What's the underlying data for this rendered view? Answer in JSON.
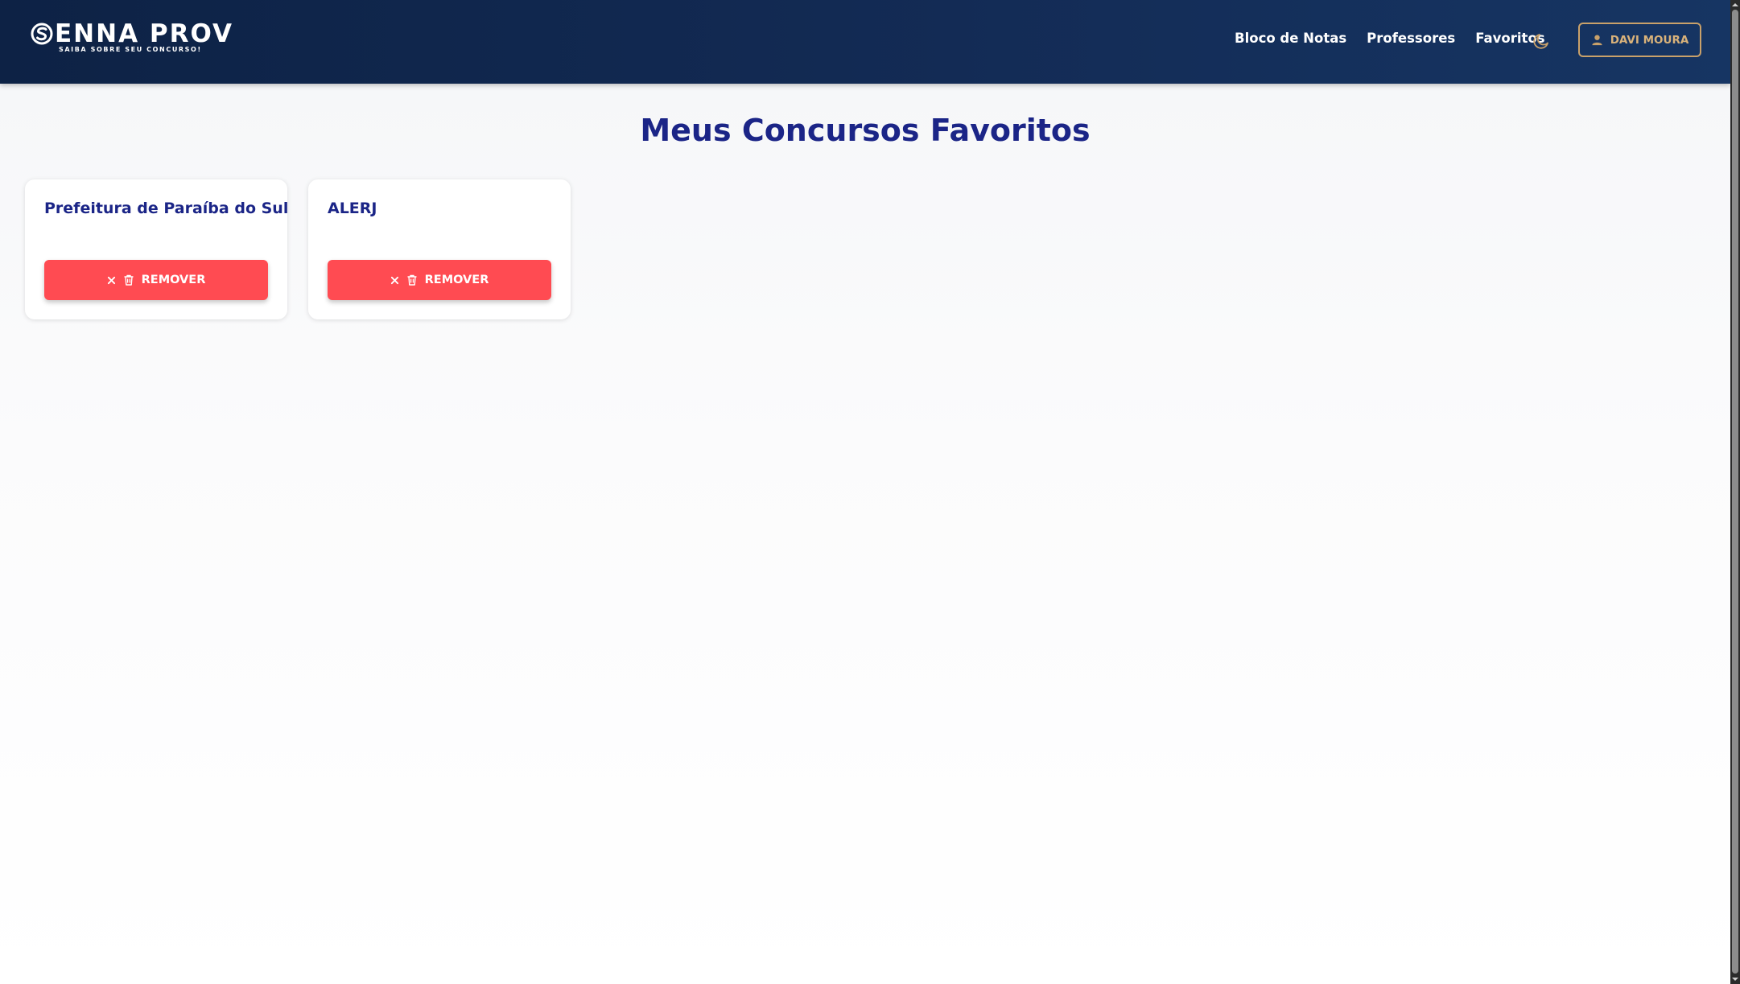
{
  "brand": {
    "name": "ENNA PROV",
    "tagline": "SAIBA SOBRE SEU CONCURSO!"
  },
  "nav": {
    "links": [
      "Bloco de Notas",
      "Professores",
      "Favoritos"
    ],
    "user_label": "DAVI MOURA"
  },
  "page": {
    "title": "Meus Concursos Favoritos"
  },
  "favorites": [
    {
      "name": "Prefeitura de Paraíba do Sul",
      "remove_label": "REMOVER"
    },
    {
      "name": "ALERJ",
      "remove_label": "REMOVER"
    }
  ],
  "colors": {
    "header_bg": "#132b55",
    "title": "#1b2587",
    "remove_button": "#ff4b52",
    "user_button_border": "#c9a16a"
  },
  "icons": {
    "theme": "moon-icon",
    "user": "user-icon",
    "remove": [
      "close-icon",
      "trash-icon"
    ]
  }
}
